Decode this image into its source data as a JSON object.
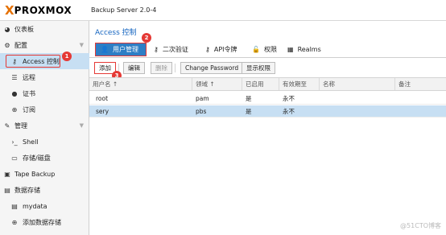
{
  "header": {
    "logo_x": "X",
    "logo_text": "PROXMOX",
    "app_title": "Backup Server 2.0-4"
  },
  "sidebar": {
    "items": [
      {
        "label": "仪表板",
        "icon": "tachometer-icon"
      },
      {
        "label": "配置",
        "icon": "gears-icon"
      },
      {
        "label": "Access 控制",
        "icon": "key-icon"
      },
      {
        "label": "远程",
        "icon": "server-icon"
      },
      {
        "label": "证书",
        "icon": "certificate-icon"
      },
      {
        "label": "订阅",
        "icon": "support-icon"
      },
      {
        "label": "管理",
        "icon": "wrench-icon"
      },
      {
        "label": "Shell",
        "icon": "terminal-icon"
      },
      {
        "label": "存储/磁盘",
        "icon": "hdd-icon"
      },
      {
        "label": "Tape Backup",
        "icon": "tape-icon"
      },
      {
        "label": "数据存储",
        "icon": "database-icon"
      },
      {
        "label": "mydata",
        "icon": "database-icon"
      },
      {
        "label": "添加数据存储",
        "icon": "plus-circle-icon"
      }
    ]
  },
  "main": {
    "title": "Access 控制",
    "tabs": [
      {
        "label": "用户管理",
        "icon": "user-icon"
      },
      {
        "label": "二次验证",
        "icon": "key-icon"
      },
      {
        "label": "API令牌",
        "icon": "key-icon"
      },
      {
        "label": "权限",
        "icon": "unlock-icon"
      },
      {
        "label": "Realms",
        "icon": "building-icon"
      }
    ],
    "toolbar": {
      "add": "添加",
      "edit": "编辑",
      "delete": "删除",
      "change_password": "Change Password",
      "show_permissions": "显示权限"
    },
    "grid": {
      "columns": [
        "用户名 ↑",
        "领域 ↑",
        "已启用",
        "有效期至",
        "名称",
        "备注"
      ],
      "rows": [
        {
          "user": "root",
          "realm": "pam",
          "enabled": "是",
          "expire": "永不",
          "name": "",
          "comment": ""
        },
        {
          "user": "sery",
          "realm": "pbs",
          "enabled": "是",
          "expire": "永不",
          "name": "",
          "comment": ""
        }
      ]
    }
  },
  "annotations": [
    "1",
    "2",
    "3"
  ],
  "watermark": "@51CTO博客",
  "colors": {
    "accent": "#2d7ec5",
    "highlight": "#e53935",
    "selected_row": "#c7dff3",
    "logo_orange": "#e57000"
  }
}
